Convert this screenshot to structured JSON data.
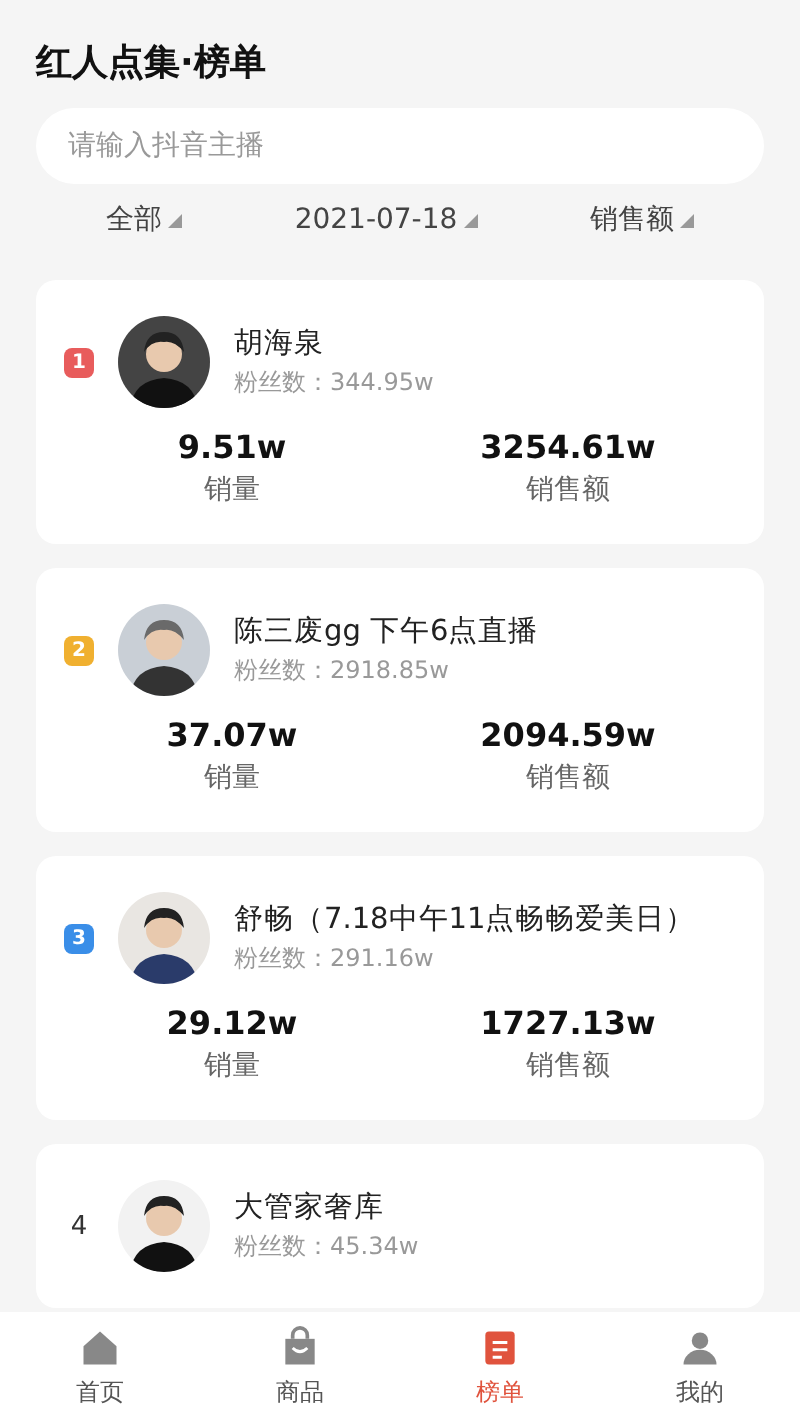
{
  "title": "红人点集·榜单",
  "search": {
    "placeholder": "请输入抖音主播"
  },
  "filters": [
    {
      "label": "全部"
    },
    {
      "label": "2021-07-18"
    },
    {
      "label": "销售额"
    }
  ],
  "rankings": [
    {
      "rank": "1",
      "kind": "badge",
      "color": "#e85c5c",
      "name": "胡海泉",
      "fans": "粉丝数：344.95w",
      "stats": [
        {
          "value": "9.51w",
          "label": "销量"
        },
        {
          "value": "3254.61w",
          "label": "销售额"
        }
      ]
    },
    {
      "rank": "2",
      "kind": "badge",
      "color": "#f0b030",
      "name": "陈三废gg 下午6点直播",
      "fans": "粉丝数：2918.85w",
      "stats": [
        {
          "value": "37.07w",
          "label": "销量"
        },
        {
          "value": "2094.59w",
          "label": "销售额"
        }
      ]
    },
    {
      "rank": "3",
      "kind": "badge",
      "color": "#3a8ee8",
      "name": "舒畅（7.18中午11点畅畅爱美日）",
      "fans": "粉丝数：291.16w",
      "stats": [
        {
          "value": "29.12w",
          "label": "销量"
        },
        {
          "value": "1727.13w",
          "label": "销售额"
        }
      ]
    },
    {
      "rank": "4",
      "kind": "plain",
      "name": "大管家奢库",
      "fans": "粉丝数：45.34w"
    }
  ],
  "nav": [
    {
      "label": "首页",
      "kind": "home",
      "selected": false
    },
    {
      "label": "商品",
      "kind": "bag",
      "selected": false
    },
    {
      "label": "榜单",
      "kind": "list",
      "selected": true
    },
    {
      "label": "我的",
      "kind": "person",
      "selected": false
    }
  ]
}
